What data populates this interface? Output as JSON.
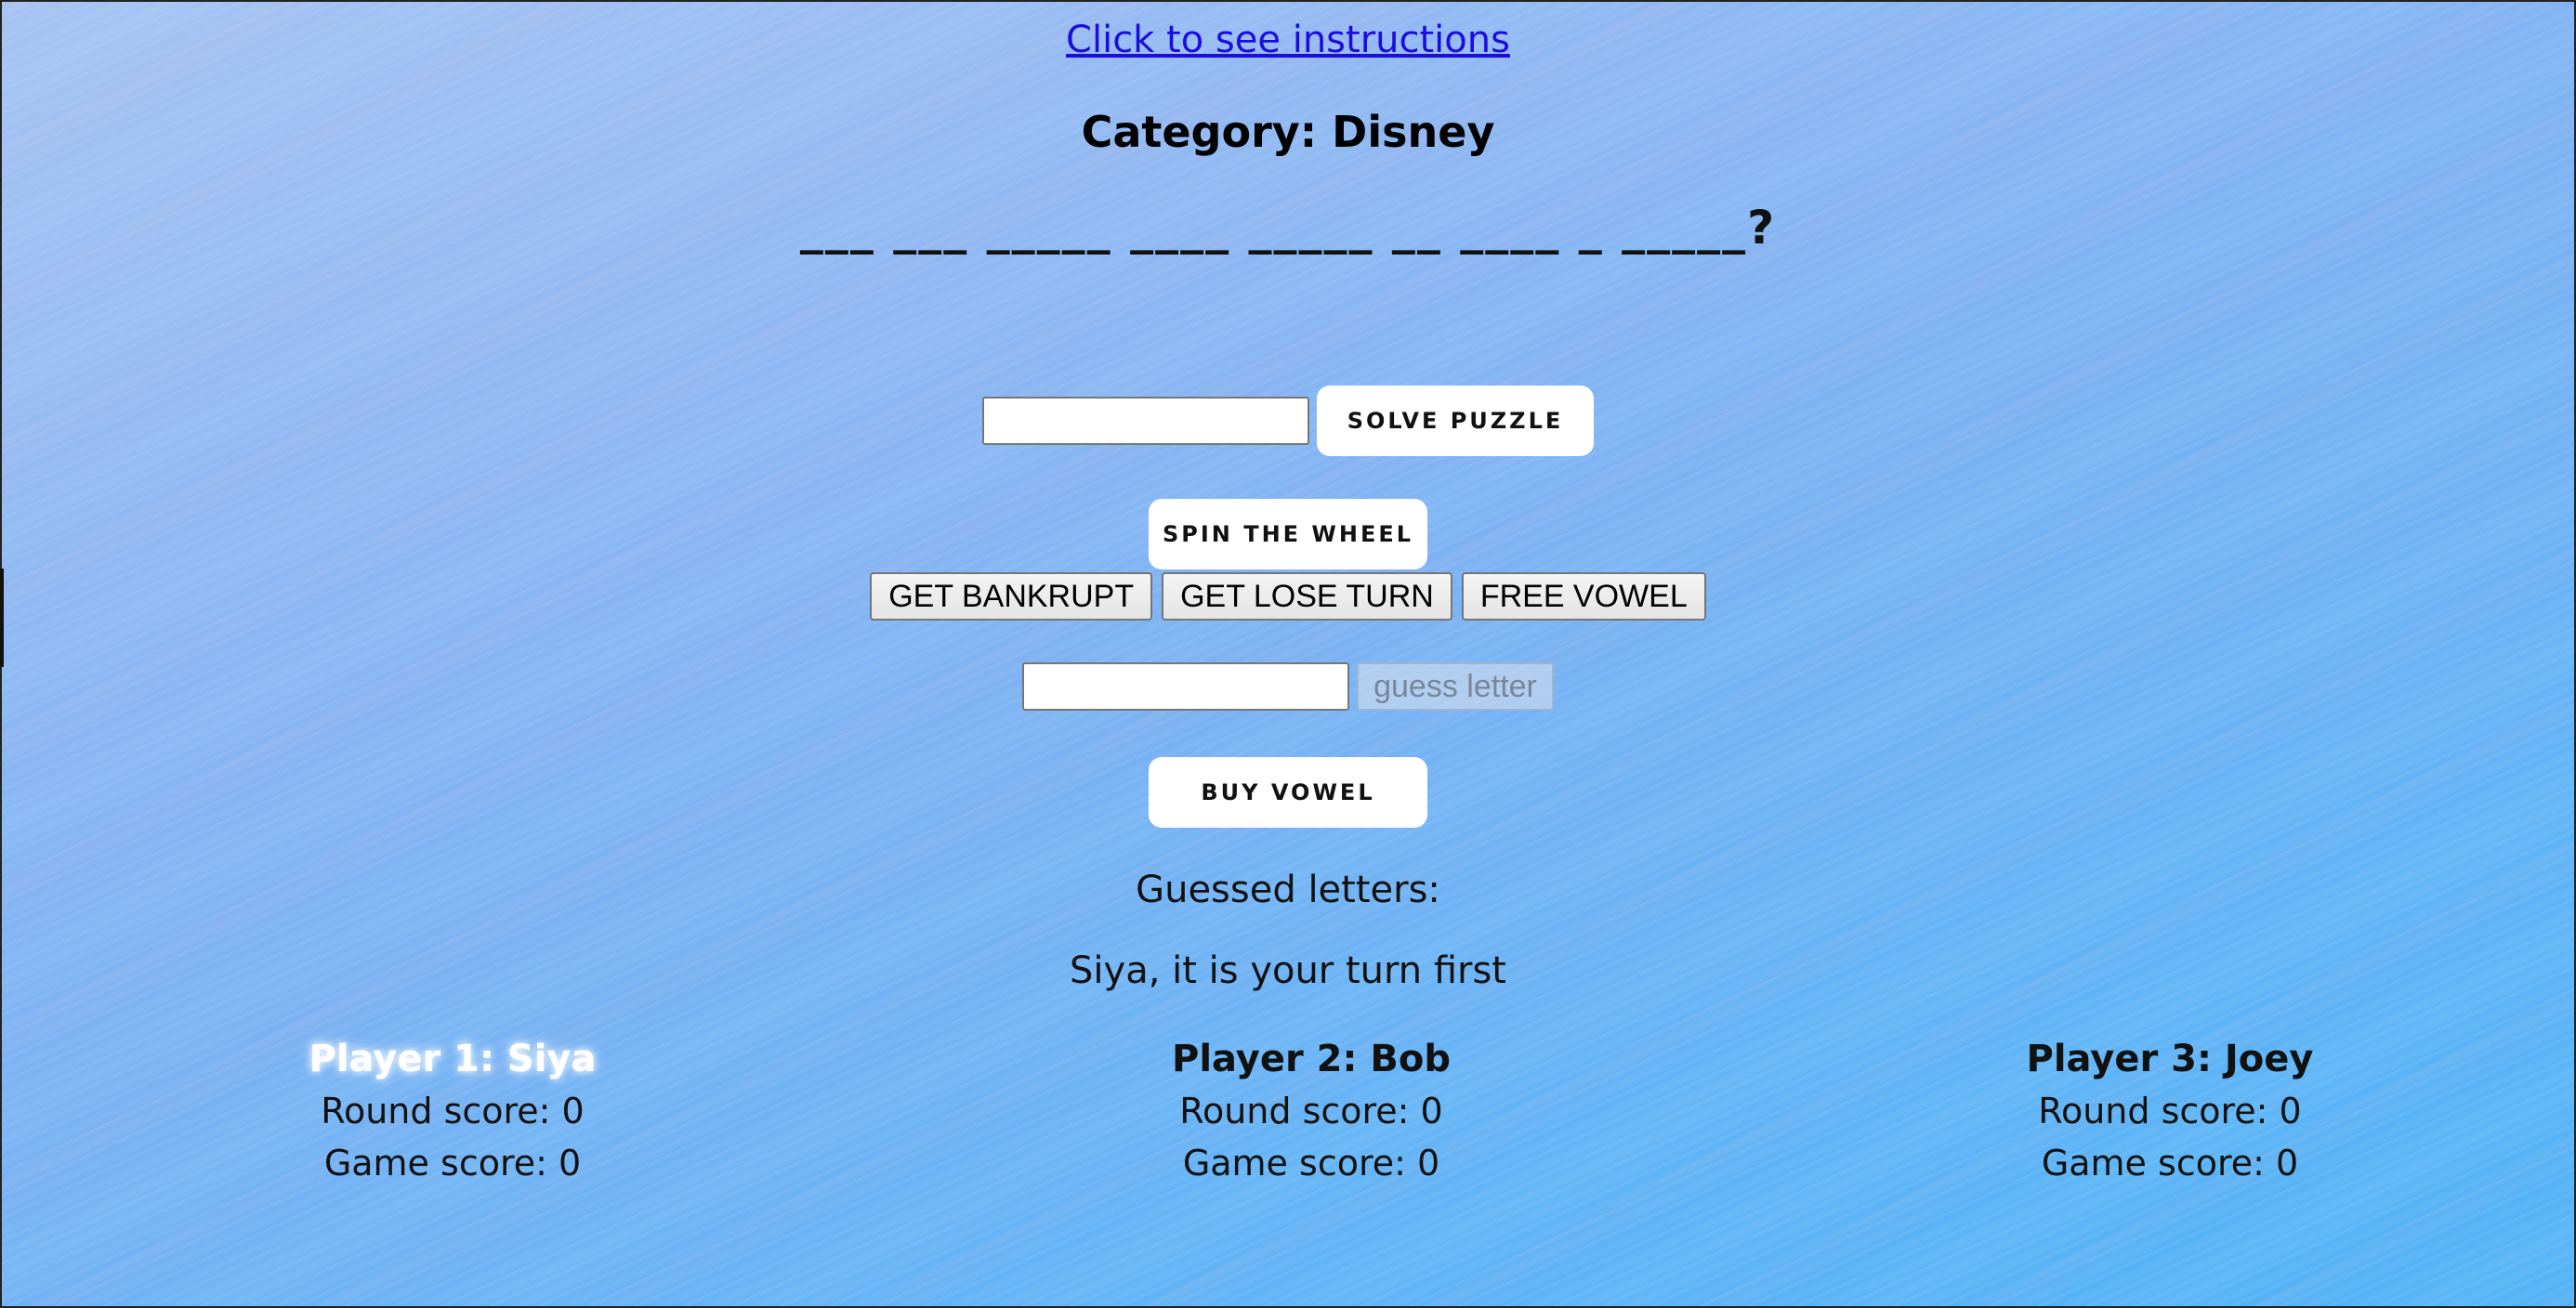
{
  "instructions_link": "Click to see instructions",
  "category": {
    "label": "Category:",
    "value": "Disney"
  },
  "puzzle_display": "___ ___ _____ ____ _____ __ ____ _ _____?",
  "solve": {
    "input_value": "",
    "button_label": "SOLVE PUZZLE"
  },
  "spin_button": "SPIN THE WHEEL",
  "actions": {
    "bankrupt": "GET BANKRUPT",
    "lose_turn": "GET LOSE TURN",
    "free_vowel": "FREE VOWEL"
  },
  "guess": {
    "input_value": "",
    "button_label": "guess letter"
  },
  "buy_vowel_button": "BUY VOWEL",
  "guessed_letters": "Guessed letters:",
  "turn_message": "Siya, it is your turn first",
  "players": [
    {
      "name": "Player 1: Siya",
      "round_score": "Round score: 0",
      "game_score": "Game score: 0",
      "active": true
    },
    {
      "name": "Player 2: Bob",
      "round_score": "Round score: 0",
      "game_score": "Game score: 0",
      "active": false
    },
    {
      "name": "Player 3: Joey",
      "round_score": "Round score: 0",
      "game_score": "Game score: 0",
      "active": false
    }
  ],
  "colors": {
    "link": "#1a0dde",
    "active_player": "#ffffff"
  }
}
